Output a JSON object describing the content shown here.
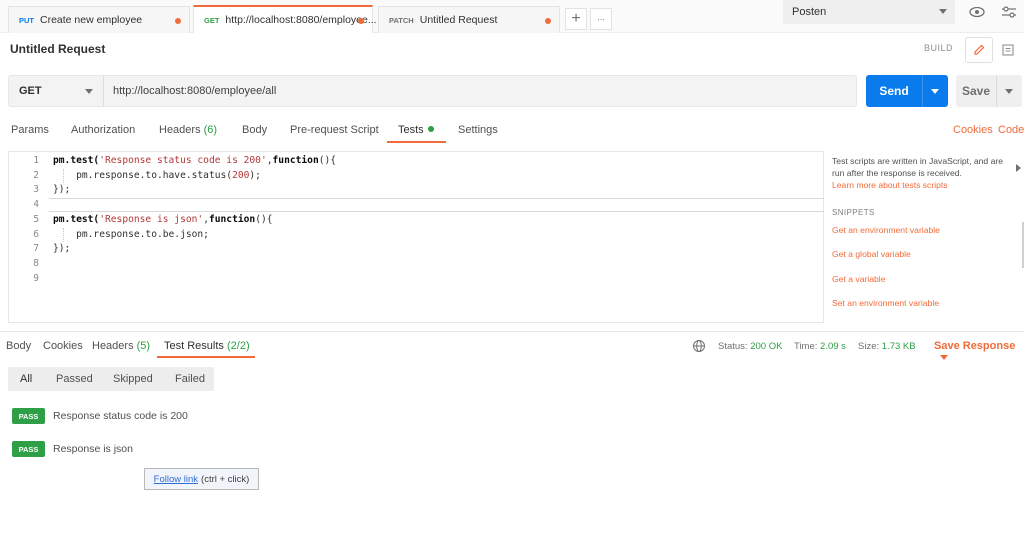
{
  "tabs": [
    {
      "method": "PUT",
      "method_color": "#097bed",
      "title": "Create new employee",
      "unsaved": true
    },
    {
      "method": "GET",
      "method_color": "#2e9f47",
      "title": "http://localhost:8080/employee...",
      "unsaved": true,
      "active": true
    },
    {
      "method": "PATCH",
      "method_color": "#707070",
      "title": "Untitled Request",
      "unsaved": true
    }
  ],
  "tab_actions": {
    "add_icon": "+",
    "more_icon": "∙∙∙"
  },
  "environment": {
    "selected": "Posten"
  },
  "request": {
    "title": "Untitled Request",
    "build_label": "BUILD",
    "method": "GET",
    "url": "http://localhost:8080/employee/all",
    "send_label": "Send",
    "save_label": "Save"
  },
  "request_tabs": [
    {
      "label": "Params"
    },
    {
      "label": "Authorization"
    },
    {
      "label": "Headers",
      "count": "(6)"
    },
    {
      "label": "Body"
    },
    {
      "label": "Pre-request Script"
    },
    {
      "label": "Tests",
      "active": true,
      "has_dot": true
    },
    {
      "label": "Settings"
    }
  ],
  "right_links": {
    "cookies": "Cookies",
    "code": "Code"
  },
  "editor": {
    "line_numbers": [
      "1",
      "2",
      "3",
      "4",
      "5",
      "6",
      "7",
      "8",
      "9"
    ]
  },
  "snippets_panel": {
    "description": "Test scripts are written in JavaScript, and are run after the response is received.",
    "learn_more": "Learn more about tests scripts",
    "heading": "SNIPPETS",
    "items": [
      "Get an environment variable",
      "Get a global variable",
      "Get a variable",
      "Set an environment variable"
    ]
  },
  "response": {
    "tabs": [
      {
        "label": "Body"
      },
      {
        "label": "Cookies"
      },
      {
        "label": "Headers",
        "count": "(5)"
      },
      {
        "label": "Test Results",
        "count": "(2/2)",
        "active": true
      }
    ],
    "status_label": "Status:",
    "status_value": "200 OK",
    "time_label": "Time:",
    "time_value": "2.09 s",
    "size_label": "Size:",
    "size_value": "1.73 KB",
    "save_response": "Save Response",
    "filters": [
      "All",
      "Passed",
      "Skipped",
      "Failed"
    ],
    "results": [
      {
        "badge": "PASS",
        "name": "Response status code is 200"
      },
      {
        "badge": "PASS",
        "name": "Response is json"
      }
    ]
  },
  "tooltip": {
    "link": "Follow link",
    "hint": "(ctrl + click)"
  },
  "colors": {
    "accent": "#f26b3a",
    "send": "#097bed",
    "pass": "#2e9f47"
  }
}
